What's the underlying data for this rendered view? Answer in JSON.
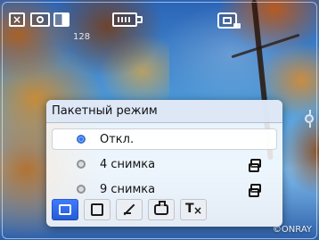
{
  "popup": {
    "title": "Пакетный режим",
    "options": [
      {
        "label": "Откл.",
        "selected": true,
        "right_icon": ""
      },
      {
        "label": "4 снимка",
        "selected": false,
        "right_icon": "burst-icon"
      },
      {
        "label": "9 снимка",
        "selected": false,
        "right_icon": "burst-icon"
      }
    ],
    "toolbar": [
      {
        "icon": "burst-mode-icon",
        "active": true
      },
      {
        "icon": "frame-icon",
        "active": false
      },
      {
        "icon": "tools-icon",
        "active": false
      },
      {
        "icon": "printer-icon",
        "active": false
      },
      {
        "icon": "text-clear-icon",
        "active": false
      }
    ]
  },
  "hud": {
    "resolution_value": "128",
    "watermark": "©ONRAY"
  }
}
